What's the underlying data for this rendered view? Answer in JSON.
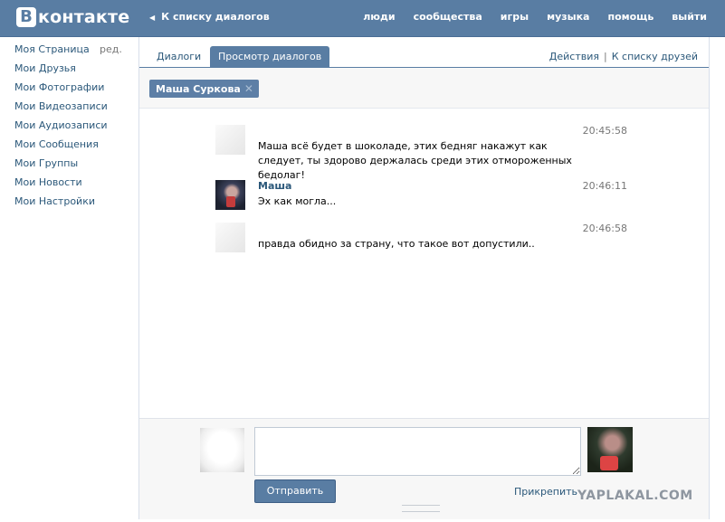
{
  "header": {
    "logo_letter": "В",
    "logo_text": "контакте",
    "back_link": "К списку диалогов",
    "nav": [
      "люди",
      "сообщества",
      "игры",
      "музыка",
      "помощь",
      "выйти"
    ]
  },
  "sidebar": {
    "items": [
      {
        "label": "Моя Страница",
        "edit": "ред."
      },
      {
        "label": "Мои Друзья"
      },
      {
        "label": "Мои Фотографии"
      },
      {
        "label": "Мои Видеозаписи"
      },
      {
        "label": "Мои Аудиозаписи"
      },
      {
        "label": "Мои Сообщения"
      },
      {
        "label": "Мои Группы"
      },
      {
        "label": "Мои Новости"
      },
      {
        "label": "Мои Настройки"
      }
    ]
  },
  "tabs": {
    "dialogs": "Диалоги",
    "view": "Просмотр диалогов",
    "actions": "Действия",
    "friends_link": "К списку друзей"
  },
  "chip": {
    "name": "Маша Суркова",
    "remove": "✕"
  },
  "messages": [
    {
      "author": "",
      "time": "20:45:58",
      "text": "Маша всё будет в шоколаде, этих бедняг накажут как следует, ты здорово держалась среди этих отмороженных бедолаг!"
    },
    {
      "author": "Маша",
      "time": "20:46:11",
      "text": "Эх как могла..."
    },
    {
      "author": "",
      "time": "20:46:58",
      "text": "правда обидно за страну, что такое вот допустили.."
    }
  ],
  "compose": {
    "input_value": "",
    "send_label": "Отправить",
    "attach_label": "Прикрепить"
  },
  "watermark": "YAPLAKAL.COM",
  "colors": {
    "brand": "#597da3",
    "link": "#2b587a",
    "muted": "#777777"
  }
}
